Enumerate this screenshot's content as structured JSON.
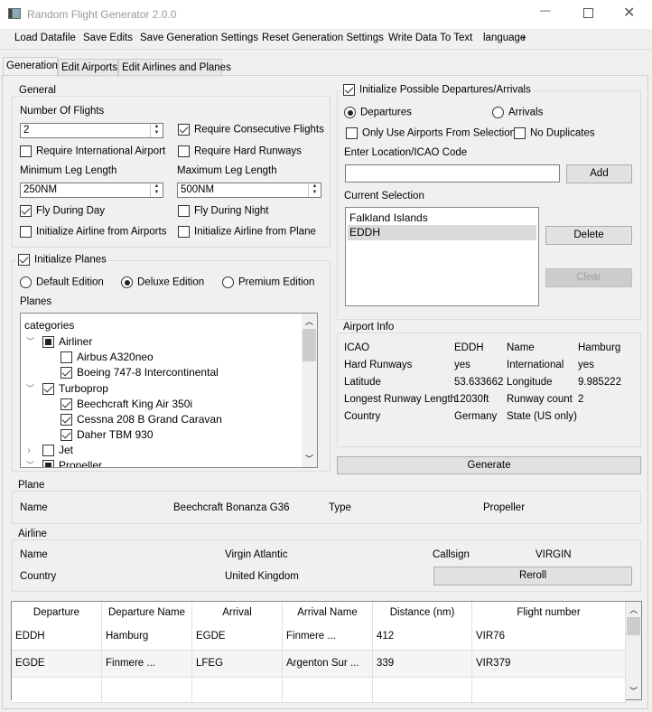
{
  "window": {
    "title": "Random Flight Generator 2.0.0"
  },
  "menu": [
    "Load Datafile",
    "Save Edits",
    "Save Generation Settings",
    "Reset Generation Settings",
    "Write Data To Text",
    "language"
  ],
  "tabs": [
    "Generation",
    "Edit Airports",
    "Edit Airlines and Planes"
  ],
  "general": {
    "title": "General",
    "num_flights_label": "Number Of Flights",
    "num_flights": "2",
    "consecutive": "Require Consecutive Flights",
    "international": "Require International Airport",
    "hard_runways": "Require Hard Runways",
    "min_leg_label": "Minimum Leg Length",
    "min_leg": "250NM",
    "max_leg_label": "Maximum Leg Length",
    "max_leg": "500NM",
    "fly_day": "Fly During Day",
    "fly_night": "Fly During Night",
    "airline_airports": "Initialize Airline from Airports",
    "airline_plane": "Initialize Airline from Plane"
  },
  "planes": {
    "title": "Initialize Planes",
    "editions": [
      "Default Edition",
      "Deluxe Edition",
      "Premium Edition"
    ],
    "planes_label": "Planes",
    "tree_header": "categories",
    "tree": [
      {
        "label": "Airliner",
        "state": "partial",
        "expanded": true,
        "children": [
          {
            "label": "Airbus A320neo",
            "checked": false
          },
          {
            "label": "Boeing 747-8 Intercontinental",
            "checked": true
          }
        ]
      },
      {
        "label": "Turboprop",
        "state": "checked",
        "expanded": true,
        "children": [
          {
            "label": "Beechcraft King Air 350i",
            "checked": true
          },
          {
            "label": "Cessna 208 B Grand Caravan",
            "checked": true
          },
          {
            "label": "Daher TBM 930",
            "checked": true
          }
        ]
      },
      {
        "label": "Jet",
        "state": "unchecked",
        "expanded": false
      },
      {
        "label": "Propeller",
        "state": "partial",
        "expanded": true
      }
    ]
  },
  "dep_arr": {
    "title": "Initialize Possible Departures/Arrivals",
    "departures": "Departures",
    "arrivals": "Arrivals",
    "only_selection": "Only Use Airports From Selection",
    "no_duplicates": "No Duplicates",
    "enter_label": "Enter Location/ICAO Code",
    "input_value": "",
    "add": "Add",
    "current_label": "Current Selection",
    "selection": [
      "Falkland Islands",
      "EDDH"
    ],
    "delete": "Delete",
    "clear": "Clear"
  },
  "airport_info": {
    "title": "Airport Info",
    "rows": [
      [
        "ICAO",
        "EDDH",
        "Name",
        "Hamburg"
      ],
      [
        "Hard Runways",
        "yes",
        "International",
        "yes"
      ],
      [
        "Latitude",
        "53.633662",
        "Longitude",
        "9.985222"
      ],
      [
        "Longest Runway Length",
        "12030ft",
        "Runway count",
        "2"
      ],
      [
        "Country",
        "Germany",
        "State (US only)",
        ""
      ]
    ]
  },
  "generate": "Generate",
  "plane": {
    "title": "Plane",
    "name_label": "Name",
    "name": "Beechcraft Bonanza G36",
    "type_label": "Type",
    "type": "Propeller"
  },
  "airline": {
    "title": "Airline",
    "name_label": "Name",
    "name": "Virgin Atlantic",
    "callsign_label": "Callsign",
    "callsign": "VIRGIN",
    "country_label": "Country",
    "country": "United Kingdom",
    "reroll": "Reroll"
  },
  "table": {
    "headers": [
      "Departure",
      "Departure Name",
      "Arrival",
      "Arrival Name",
      "Distance (nm)",
      "Flight number"
    ],
    "rows": [
      [
        "EDDH",
        "Hamburg",
        "EGDE",
        "Finmere ...",
        "412",
        "VIR76"
      ],
      [
        "EGDE",
        "Finmere ...",
        "LFEG",
        "Argenton Sur ...",
        "339",
        "VIR379"
      ]
    ]
  }
}
